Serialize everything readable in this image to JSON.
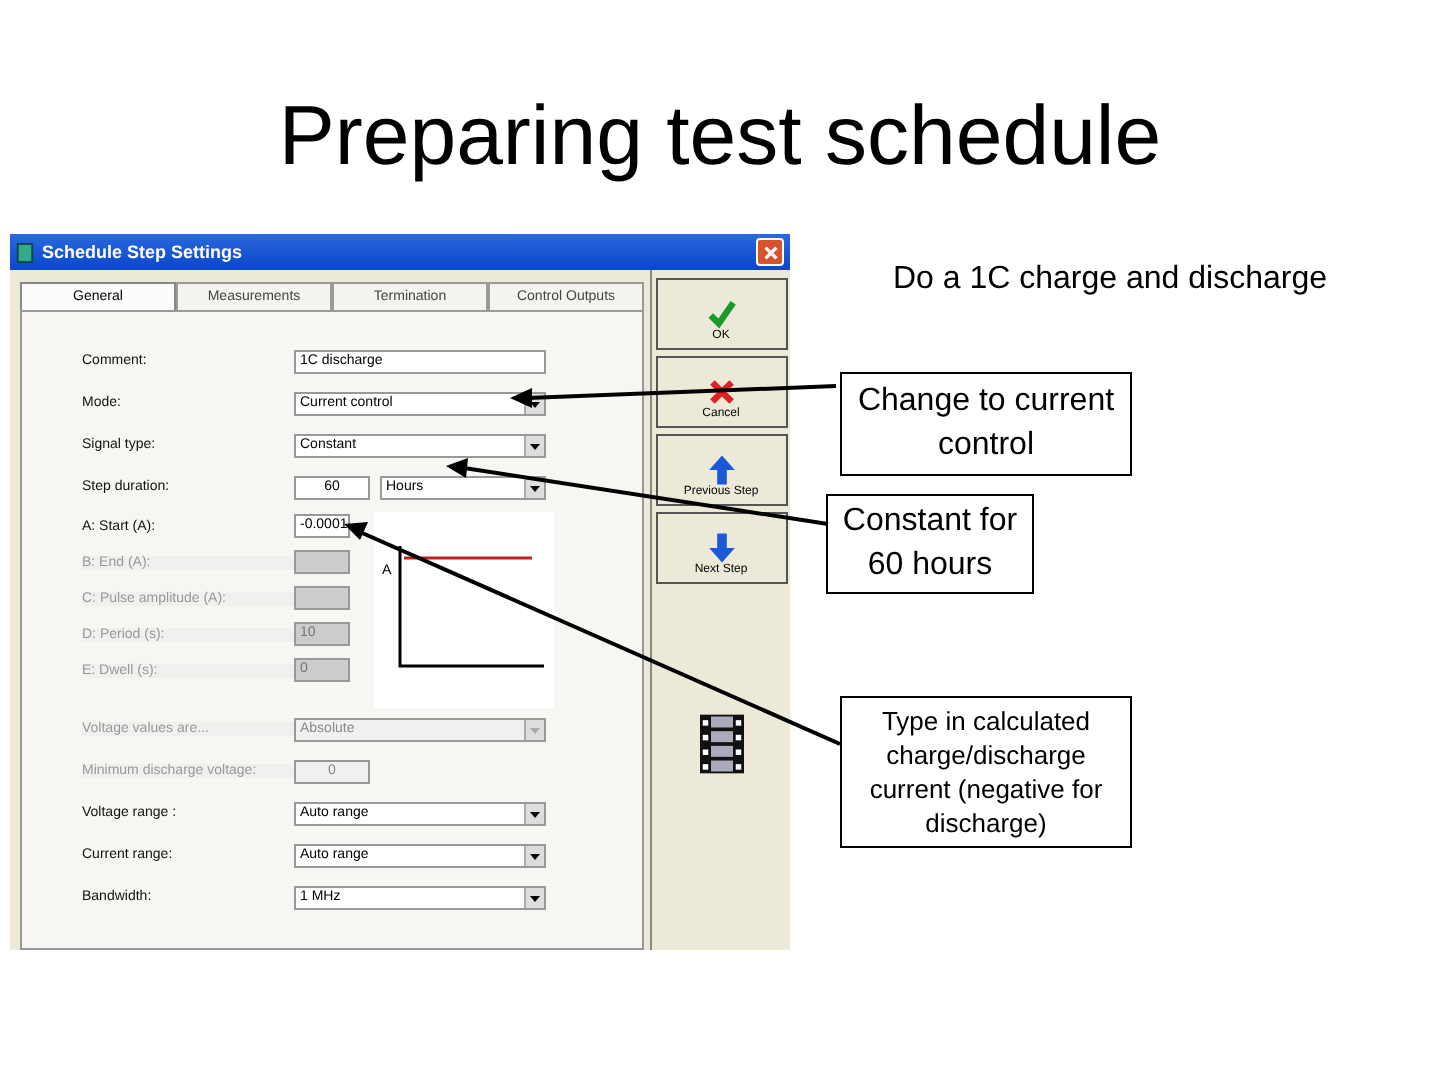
{
  "slide": {
    "title": "Preparing test schedule"
  },
  "dialog": {
    "title": "Schedule Step Settings",
    "tabs": [
      {
        "label": "General",
        "selected": true
      },
      {
        "label": "Measurements",
        "selected": false
      },
      {
        "label": "Termination",
        "selected": false
      },
      {
        "label": "Control Outputs",
        "selected": false
      }
    ],
    "fields": [
      {
        "kind": "text",
        "label": "Comment:",
        "value": "1C discharge",
        "disabled": false
      },
      {
        "kind": "combo",
        "label": "Mode:",
        "value": "Current control",
        "disabled": false
      },
      {
        "kind": "combo",
        "label": "Signal type:",
        "value": "Constant",
        "disabled": false
      },
      {
        "kind": "duration",
        "label": "Step duration:",
        "value": "60",
        "unit": "Hours",
        "disabled": false
      }
    ],
    "signal_fields": [
      {
        "label": "A: Start (A):",
        "value": "-0.0001",
        "disabled": false
      },
      {
        "label": "B: End (A):",
        "disabled": true
      },
      {
        "label": "C: Pulse amplitude (A):",
        "disabled": true
      },
      {
        "label": "D: Period (s):",
        "value": "10",
        "disabled": true
      },
      {
        "label": "E: Dwell (s):",
        "value": "0",
        "disabled": true
      }
    ],
    "graph_label": "A",
    "lower_fields": [
      {
        "kind": "combo",
        "label": "Voltage values are...",
        "value": "Absolute",
        "disabled": true
      },
      {
        "kind": "number",
        "label": "Minimum discharge voltage:",
        "value": "0",
        "disabled": true
      },
      {
        "kind": "combo",
        "label": "Voltage range :",
        "value": "Auto range",
        "disabled": false
      },
      {
        "kind": "combo",
        "label": "Current range:",
        "value": "Auto range",
        "disabled": false
      },
      {
        "kind": "combo",
        "label": "Bandwidth:",
        "value": "1 MHz",
        "disabled": false
      }
    ],
    "buttons": [
      {
        "kind": "ok",
        "label": "OK"
      },
      {
        "kind": "cancel",
        "label": "Cancel"
      },
      {
        "kind": "up",
        "label": "Previous Step"
      },
      {
        "kind": "down",
        "label": "Next Step"
      }
    ]
  },
  "callouts": [
    {
      "text": "Do a 1C charge and discharge",
      "boxed": false
    },
    {
      "text": "Change to current control",
      "boxed": true
    },
    {
      "text": "Constant for 60 hours",
      "boxed": true
    },
    {
      "text": "Type in calculated charge/discharge current (negative for discharge)",
      "boxed": true
    }
  ]
}
